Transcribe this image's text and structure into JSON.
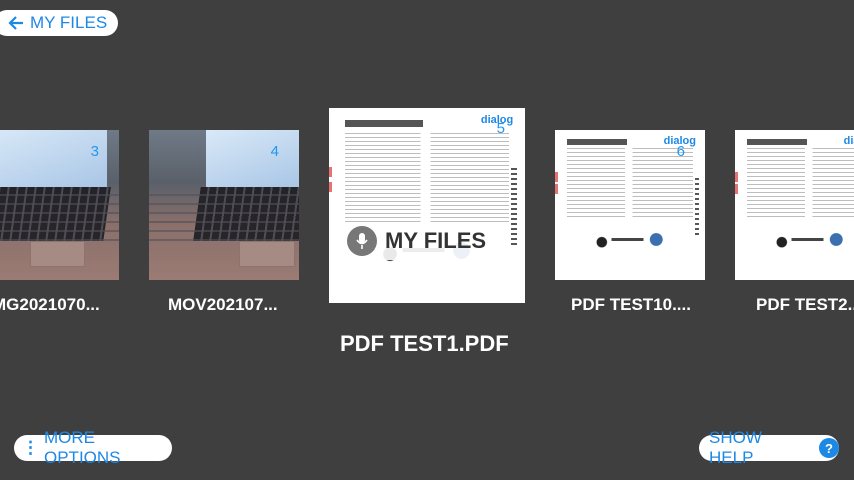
{
  "nav": {
    "back_label": "MY FILES"
  },
  "files": [
    {
      "name": "MG2021070...",
      "number": "3",
      "kind": "photo"
    },
    {
      "name": "MOV202107...",
      "number": "4",
      "kind": "photo"
    },
    {
      "name": "PDF TEST1.PDF",
      "number": "5",
      "kind": "pdf",
      "selected": true
    },
    {
      "name": "PDF TEST10....",
      "number": "6",
      "kind": "pdf"
    },
    {
      "name": "PDF TEST2...",
      "number": "",
      "kind": "pdf"
    }
  ],
  "voice_overlay": {
    "label": "MY FILES",
    "icon": "microphone-icon"
  },
  "footer": {
    "more_label": "MORE OPTIONS",
    "help_label": "SHOW HELP",
    "help_icon": "?"
  },
  "colors": {
    "accent": "#1e88e5",
    "background": "#3f3f3f"
  }
}
